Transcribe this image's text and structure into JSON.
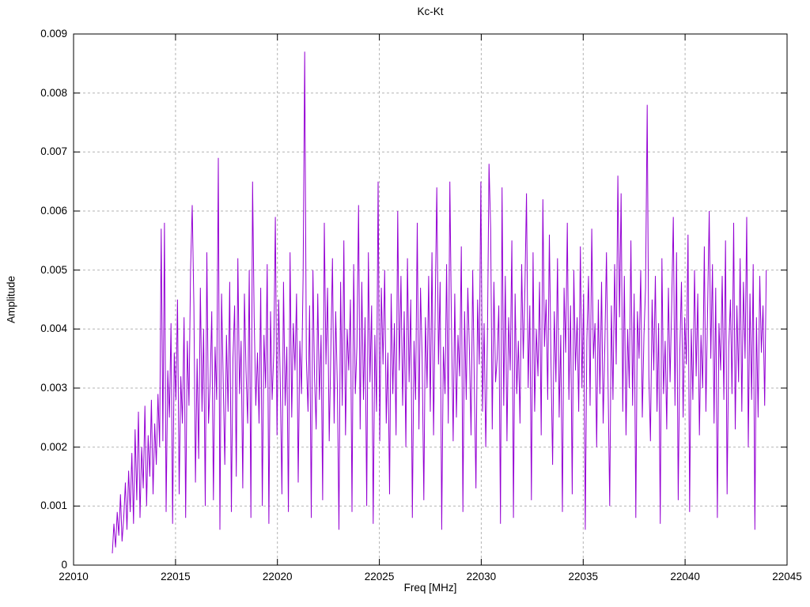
{
  "chart_data": {
    "type": "line",
    "title": "Kc-Kt",
    "xlabel": "Freq [MHz]",
    "ylabel": "Amplitude",
    "xlim": [
      22010,
      22045
    ],
    "ylim": [
      0,
      0.009
    ],
    "xticks": [
      22010,
      22015,
      22020,
      22025,
      22030,
      22035,
      22040,
      22045
    ],
    "xtick_labels": [
      "22010",
      "22015",
      "22020",
      "22025",
      "22030",
      "22035",
      "22040",
      "22045"
    ],
    "yticks": [
      0,
      0.001,
      0.002,
      0.003,
      0.004,
      0.005,
      0.006,
      0.007,
      0.008,
      0.009
    ],
    "ytick_labels": [
      "0",
      "0.001",
      "0.002",
      "0.003",
      "0.004",
      "0.005",
      "0.006",
      "0.007",
      "0.008",
      "0.009"
    ],
    "grid": true,
    "legend": "none",
    "line_color": "#9400d3",
    "grid_color": "#b3b3b3",
    "border_color": "#000000",
    "text_color": "#000000",
    "series": [
      {
        "name": "Kc-Kt",
        "x_start": 22011.9,
        "x_step": 0.08,
        "scale": 0.0001,
        "values": [
          2,
          7,
          3,
          9,
          5,
          12,
          4,
          8,
          14,
          6,
          16,
          9,
          19,
          7,
          23,
          11,
          26,
          8,
          20,
          13,
          27,
          10,
          22,
          15,
          28,
          12,
          24,
          17,
          29,
          20,
          57,
          21,
          58,
          9,
          33,
          25,
          41,
          7,
          36,
          28,
          45,
          12,
          32,
          24,
          42,
          8,
          38,
          27,
          50,
          61,
          44,
          14,
          35,
          18,
          47,
          26,
          40,
          10,
          53,
          24,
          31,
          43,
          11,
          37,
          28,
          69,
          6,
          46,
          31,
          17,
          39,
          26,
          48,
          9,
          35,
          44,
          15,
          52,
          29,
          38,
          13,
          46,
          33,
          24,
          50,
          8,
          65,
          42,
          27,
          36,
          24,
          47,
          10,
          39,
          30,
          51,
          7,
          43,
          28,
          36,
          59,
          22,
          45,
          31,
          12,
          48,
          27,
          37,
          9,
          53,
          25,
          41,
          33,
          46,
          14,
          38,
          29,
          49,
          87,
          35,
          26,
          44,
          8,
          50,
          32,
          23,
          46,
          28,
          39,
          11,
          58,
          34,
          47,
          21,
          36,
          52,
          24,
          43,
          30,
          6,
          48,
          27,
          55,
          22,
          40,
          33,
          45,
          9,
          51,
          29,
          37,
          61,
          23,
          48,
          28,
          42,
          10,
          53,
          31,
          44,
          7,
          39,
          26,
          65,
          21,
          47,
          34,
          50,
          24,
          36,
          12,
          46,
          29,
          41,
          22,
          60,
          33,
          49,
          27,
          43,
          20,
          52,
          31,
          45,
          8,
          38,
          28,
          58,
          23,
          47,
          35,
          11,
          42,
          30,
          49,
          26,
          53,
          22,
          44,
          64,
          34,
          48,
          6,
          37,
          29,
          51,
          24,
          65,
          40,
          21,
          46,
          25,
          39,
          32,
          54,
          9,
          43,
          28,
          47,
          36,
          22,
          50,
          30,
          13,
          45,
          34,
          65,
          26,
          41,
          20,
          38,
          68,
          57,
          23,
          48,
          31,
          35,
          44,
          7,
          64,
          27,
          49,
          21,
          42,
          33,
          55,
          8,
          46,
          29,
          38,
          24,
          51,
          35,
          47,
          63,
          30,
          44,
          11,
          53,
          26,
          40,
          32,
          48,
          22,
          62,
          37,
          45,
          28,
          56,
          34,
          17,
          43,
          31,
          52,
          25,
          39,
          9,
          47,
          36,
          58,
          28,
          44,
          12,
          50,
          33,
          42,
          26,
          54,
          30,
          46,
          6,
          38,
          49,
          27,
          57,
          35,
          41,
          20,
          45,
          29,
          48,
          24,
          37,
          53,
          31,
          10,
          44,
          28,
          51,
          34,
          66,
          42,
          63,
          26,
          49,
          22,
          40,
          30,
          55,
          27,
          46,
          8,
          43,
          35,
          50,
          25,
          39,
          47,
          78,
          32,
          21,
          45,
          33,
          49,
          26,
          41,
          7,
          52,
          29,
          38,
          23,
          47,
          31,
          44,
          59,
          27,
          53,
          11,
          36,
          48,
          25,
          42,
          34,
          56,
          9,
          40,
          28,
          50,
          32,
          46,
          22,
          39,
          30,
          54,
          26,
          43,
          60,
          35,
          51,
          24,
          47,
          8,
          41,
          33,
          49,
          28,
          55,
          12,
          37,
          45,
          29,
          58,
          23,
          44,
          31,
          52,
          26,
          48,
          35,
          59,
          20,
          46,
          28,
          51,
          6,
          42,
          25,
          49,
          36,
          44,
          27,
          50
        ]
      }
    ]
  }
}
